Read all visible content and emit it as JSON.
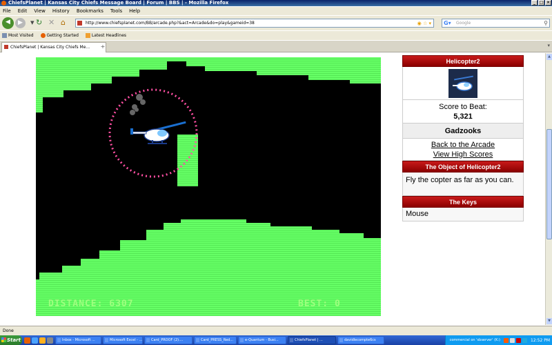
{
  "window": {
    "title": "ChiefsPlanet | Kansas City Chiefs Message Board | Forum | BBS | - Mozilla Firefox",
    "controls": [
      "_",
      "□",
      "×"
    ]
  },
  "menu": [
    "File",
    "Edit",
    "View",
    "History",
    "Bookmarks",
    "Tools",
    "Help"
  ],
  "nav": {
    "url": "http://www.chiefsplanet.com/BB/arcade.php?&act=Arcade&do=play&gameid=38",
    "search_placeholder": "Google",
    "back_icon": "back-arrow-icon",
    "forward_icon": "forward-arrow-icon"
  },
  "bookmarks": [
    {
      "label": "Most Visited",
      "icon": "gear-icon"
    },
    {
      "label": "Getting Started",
      "icon": "firefox-icon"
    },
    {
      "label": "Latest Headlines",
      "icon": "rss-icon"
    }
  ],
  "tab": {
    "label": "ChiefsPlanet | Kansas City Chiefs Me..."
  },
  "game": {
    "distance_label": "DISTANCE:",
    "distance_value": "6307",
    "best_label": "BEST:",
    "best_value": "0",
    "colors": {
      "wall": "#66ff66",
      "background": "#000000",
      "ring": "#ff4fa3"
    }
  },
  "sidebar": {
    "game_title": "Helicopter2",
    "score_label": "Score to Beat:",
    "score_value": "5,321",
    "user": "Gadzooks",
    "links": [
      "Back to the Arcade",
      "View High Scores"
    ],
    "object_header": "The Object of Helicopter2",
    "object_text": "Fly the copter as far as you can.",
    "keys_header": "The Keys",
    "keys_text": "Mouse"
  },
  "status": {
    "text": "Done"
  },
  "taskbar": {
    "start": "Start",
    "tasks": [
      "Inbox - Microsoft ...",
      "Microsoft Excel - ...",
      "Card_PROOF (2)....",
      "Card_PRESS_Red...",
      "e-Quantum - Busi...",
      "ChiefsPlanet | ...",
      "davidlecompte6cs"
    ],
    "tray_text": "commercial on 'sbserver' (K:)",
    "clock": "12:52 PM"
  }
}
